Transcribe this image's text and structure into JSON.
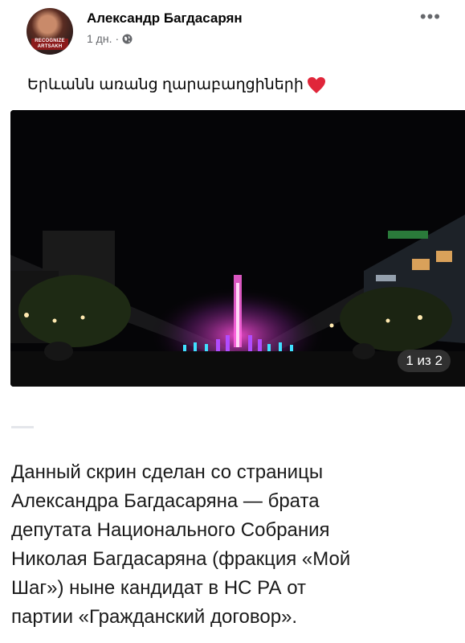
{
  "post": {
    "author_name": "Александр Багдасарян",
    "timestamp": "1 дн.",
    "separator": "·",
    "privacy_icon": "globe-icon",
    "more_label": "•••",
    "text": "Երևանն առանց ղարաբաղցիների",
    "emoji_icon": "heart-icon",
    "avatar_badge": "RECOGNIZE ARTSAKH",
    "photo_counter": "1 из 2"
  },
  "caption": {
    "lines": [
      "Данный скрин сделан со страницы",
      "Александра Багдасаряна — брата",
      "депутата Национального Собрания",
      "Николая Багдасаряна (фракция «Мой",
      "Шаг») ныне кандидат в НС РА от",
      "партии «Гражданский договор»."
    ]
  },
  "colors": {
    "meta_text": "#65676b",
    "heart": "#e0263a",
    "photo_bg": "#050507"
  }
}
